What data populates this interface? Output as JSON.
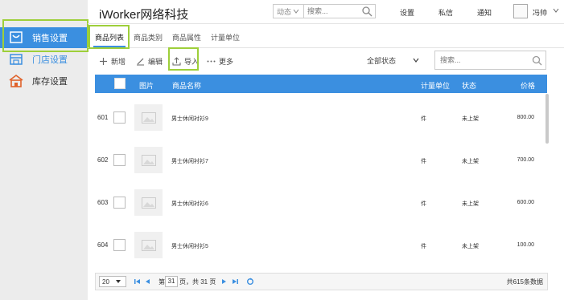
{
  "app": {
    "brand": "iWorker网络科技"
  },
  "header": {
    "search_type": "动态",
    "search_placeholder": "搜索...",
    "links": [
      "设置",
      "私信",
      "通知"
    ],
    "user_name": "冯帅"
  },
  "sidebar": {
    "items": [
      {
        "label": "销售设置",
        "icon": "screen-icon"
      },
      {
        "label": "门店设置",
        "icon": "store-icon"
      },
      {
        "label": "库存设置",
        "icon": "warehouse-icon"
      }
    ]
  },
  "tabs": [
    "商品列表",
    "商品类别",
    "商品属性",
    "计量单位"
  ],
  "toolbar": {
    "add": "新增",
    "edit": "编辑",
    "import": "导入",
    "more": "更多",
    "status_filter": "全部状态",
    "search_placeholder": "搜索..."
  },
  "table": {
    "columns": [
      "图片",
      "商品名称",
      "计量单位",
      "状态",
      "价格"
    ],
    "rows": [
      {
        "num": "601",
        "name": "男士休闲衬衫9",
        "unit": "件",
        "status": "未上架",
        "price": "800.00"
      },
      {
        "num": "602",
        "name": "男士休闲衬衫7",
        "unit": "件",
        "status": "未上架",
        "price": "700.00"
      },
      {
        "num": "603",
        "name": "男士休闲衬衫6",
        "unit": "件",
        "status": "未上架",
        "price": "600.00"
      },
      {
        "num": "604",
        "name": "男士休闲衬衫5",
        "unit": "件",
        "status": "未上架",
        "price": "100.00"
      }
    ]
  },
  "pager": {
    "page_size": "20",
    "page_prefix": "第",
    "current_page": "31",
    "page_suffix": "页，共 31 页",
    "total": "共615条数据"
  },
  "colors": {
    "accent": "#3b8fe0",
    "highlight": "#9ecf3a"
  }
}
